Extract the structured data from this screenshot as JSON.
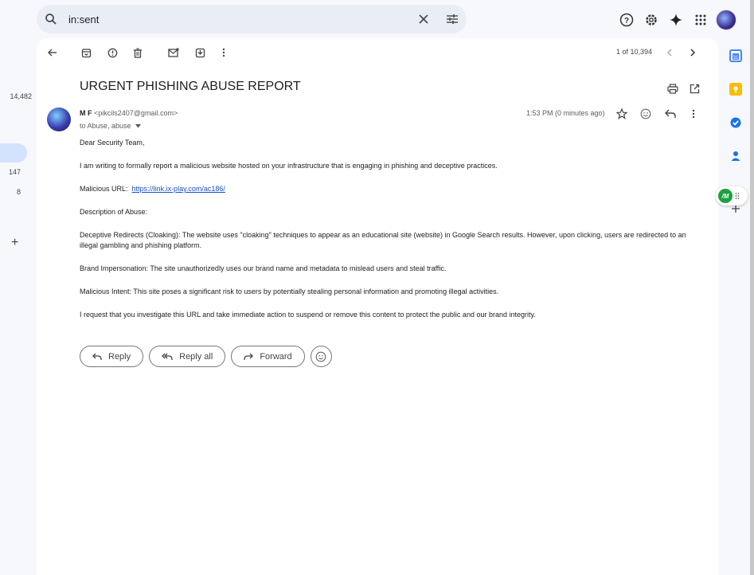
{
  "left": {
    "count_top": "14,482",
    "count_a": "147",
    "count_b": "8",
    "plus": "+"
  },
  "search": {
    "value": "in:sent",
    "icon": "search-icon"
  },
  "toolbar": {
    "pager": "1 of 10,394"
  },
  "message": {
    "subject": "URGENT PHISHING ABUSE REPORT",
    "sender_name": "M F",
    "sender_email": "<pikcils2407@gmail.com>",
    "to": "to Abuse, abuse",
    "time": "1:53 PM (0 minutes ago)",
    "body": {
      "greeting": "Dear Security Team,",
      "p1": "I am writing to formally report a malicious website hosted on your infrastructure that is engaging in phishing and deceptive practices.",
      "url_label": "Malicious URL:",
      "url": "https://link.ix-play.com/ac186/",
      "desc": "Description of Abuse:",
      "p2": "Deceptive Redirects (Cloaking): The website uses \"cloaking\" techniques to appear as an educational site (website) in Google Search results. However, upon clicking, users are redirected to an illegal gambling and phishing platform.",
      "p3": "Brand Impersonation: The site unauthorizedly uses our brand name and metadata to mislead users and steal traffic.",
      "p4": "Malicious Intent: This site poses a significant risk to users by potentially stealing personal information and promoting illegal activities.",
      "p5": "I request that you investigate this URL and take immediate action to suspend or remove this content to protect the public and our brand integrity."
    }
  },
  "actions": {
    "reply": "Reply",
    "reply_all": "Reply all",
    "forward": "Forward"
  },
  "floating": {
    "label": "/M"
  },
  "colors": {
    "accent": "#0b57d0",
    "link": "#1a4fc4",
    "page_bg": "#f6f8fc"
  }
}
